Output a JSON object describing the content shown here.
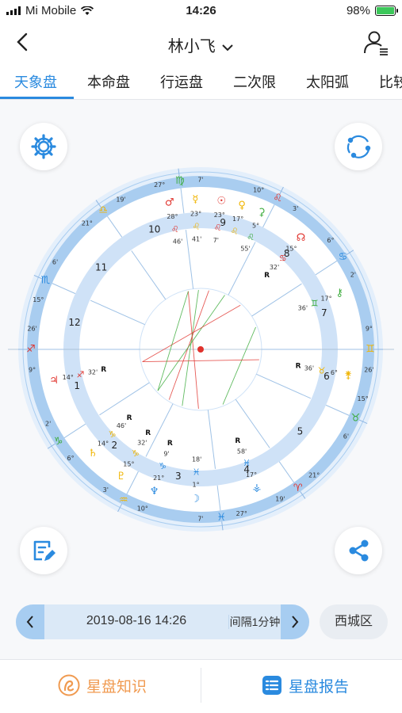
{
  "status_bar": {
    "carrier": "Mi Mobile",
    "time": "14:26",
    "battery": "98%",
    "battery_level": 0.98
  },
  "nav": {
    "title": "林小飞",
    "title_chevron": "chevron-down-icon"
  },
  "tabs": [
    "天象盘",
    "本命盘",
    "行运盘",
    "二次限",
    "太阳弧",
    "比较"
  ],
  "active_tab": 0,
  "chart": {
    "houses": [
      "1",
      "2",
      "3",
      "4",
      "5",
      "6",
      "7",
      "8",
      "9",
      "10",
      "11",
      "12"
    ],
    "cusps": [
      {
        "sign": "♐",
        "deg": "9°",
        "min": "26'"
      },
      {
        "sign": "♑",
        "deg": "6°",
        "min": "2'"
      },
      {
        "sign": "♒",
        "deg": "10°",
        "min": "3'"
      },
      {
        "sign": "♓",
        "deg": "27°",
        "min": "7'"
      },
      {
        "sign": "♈",
        "deg": "21°",
        "min": "19'"
      },
      {
        "sign": "♉",
        "deg": "15°",
        "min": "6'"
      },
      {
        "sign": "♊",
        "deg": "9°",
        "min": "26'"
      },
      {
        "sign": "♋",
        "deg": "6°",
        "min": "2'"
      },
      {
        "sign": "♌",
        "deg": "10°",
        "min": "3'"
      },
      {
        "sign": "♍",
        "deg": "27°",
        "min": "7'"
      },
      {
        "sign": "♎",
        "deg": "21°",
        "min": "19'"
      },
      {
        "sign": "♏",
        "deg": "15°",
        "min": "6'"
      }
    ],
    "planets": [
      {
        "glyph": "♂",
        "deg": "28°",
        "sign": "♌",
        "min": "46'",
        "retro": ""
      },
      {
        "glyph": "☿",
        "deg": "23°",
        "sign": "♌",
        "min": "41'",
        "retro": ""
      },
      {
        "glyph": "☉",
        "deg": "23°",
        "sign": "♌",
        "min": "7'",
        "retro": ""
      },
      {
        "glyph": "⚳",
        "deg": "5°",
        "sign": "♌",
        "min": "55'",
        "retro": ""
      },
      {
        "glyph": "☊",
        "deg": "15°",
        "sign": "♋",
        "min": "32'",
        "retro": "R"
      },
      {
        "glyph": "⚷",
        "deg": "17°",
        "sign": "♊",
        "min": "36'",
        "retro": ""
      },
      {
        "glyph": "⚵",
        "deg": "6°",
        "sign": "♉",
        "min": "36'",
        "retro": "R"
      },
      {
        "glyph": "⚶",
        "deg": "17°",
        "sign": "♓",
        "min": "58'",
        "retro": "R"
      },
      {
        "glyph": "☽",
        "deg": "1°",
        "sign": "♓",
        "min": "18'",
        "retro": ""
      },
      {
        "glyph": "♆",
        "deg": "21°",
        "sign": "♑",
        "min": "9'",
        "retro": "R"
      },
      {
        "glyph": "♇",
        "deg": "15°",
        "sign": "♑",
        "min": "32'",
        "retro": "R"
      },
      {
        "glyph": "♄",
        "deg": "14°",
        "sign": "♑",
        "min": "46'",
        "retro": "R"
      },
      {
        "glyph": "♃",
        "deg": "14°",
        "sign": "♐",
        "min": "32'",
        "retro": "R"
      },
      {
        "glyph": "♀",
        "deg": "17°",
        "sign": "♌",
        "min": "",
        "retro": ""
      }
    ]
  },
  "date_bar": {
    "prev_icon": "chevron-left-icon",
    "datetime": "2019-08-16 14:26",
    "interval": "间隔1分钟",
    "next_icon": "chevron-right-icon"
  },
  "location": "西城区",
  "bottom": {
    "knowledge": "星盘知识",
    "report": "星盘报告"
  },
  "colors": {
    "accent": "#2a8adf",
    "orange": "#f09a50",
    "red": "#e0322c",
    "green": "#3aab3a"
  }
}
